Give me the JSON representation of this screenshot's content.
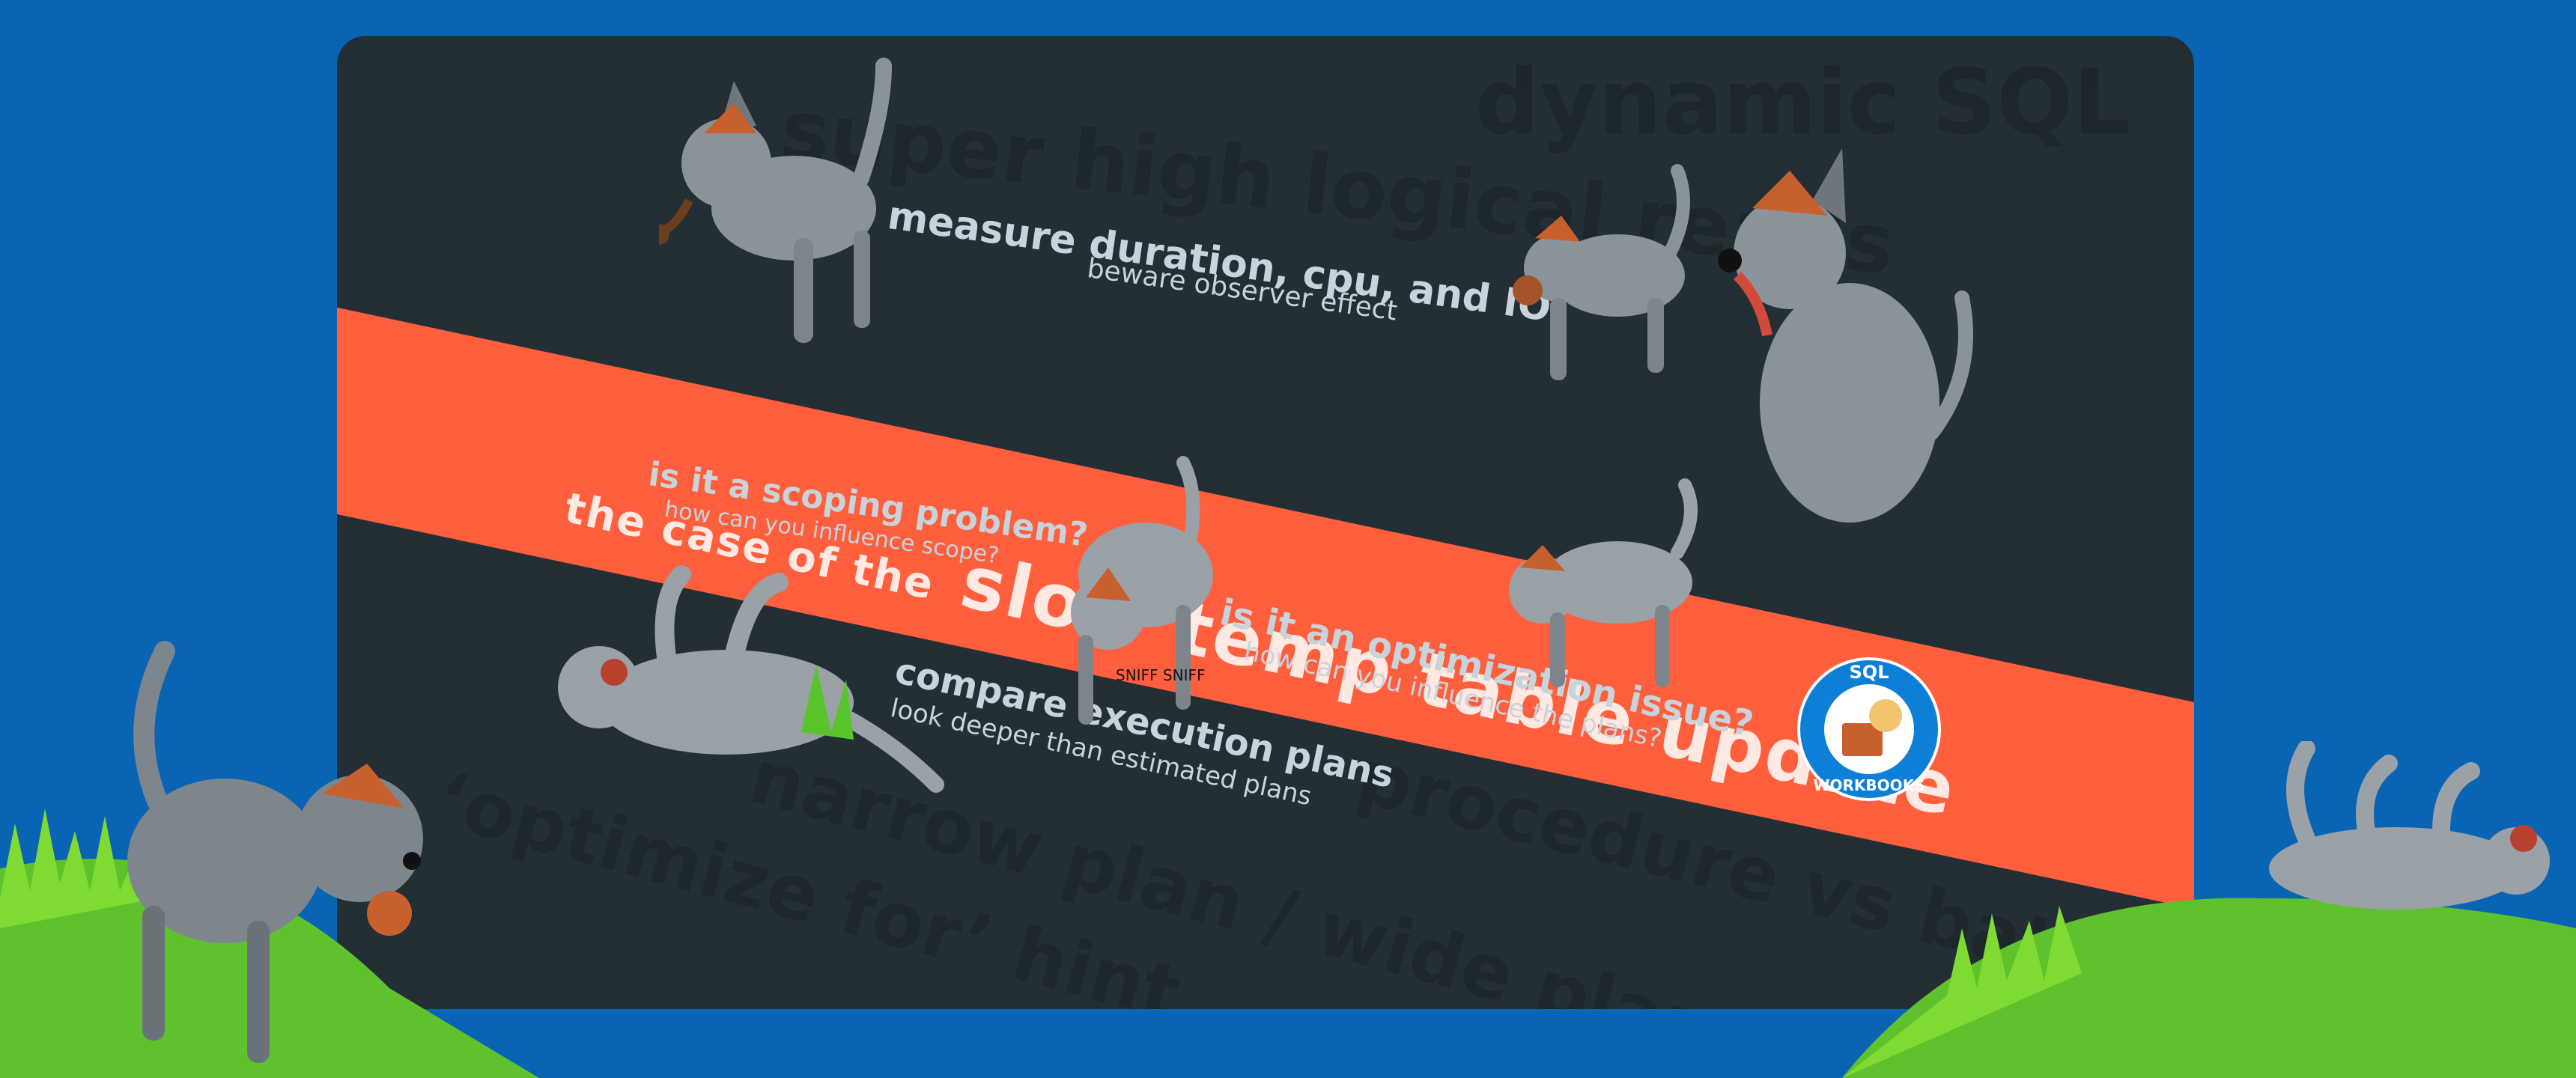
{
  "title": {
    "lead": "the case of the",
    "rest": "slow temp table update"
  },
  "notes": {
    "measure": {
      "main": "measure duration, cpu, and IO",
      "sub": "beware observer effect"
    },
    "scoping": {
      "main": "is it a scoping problem?",
      "sub": "how can you influence scope?"
    },
    "optimization": {
      "main": "is it an optimization issue?",
      "sub": "how can you influence the plans?"
    },
    "compare": {
      "main": "compare execution plans",
      "sub": "look deeper than estimated plans"
    }
  },
  "background_phrases": {
    "dynamic_sql": "dynamic SQL",
    "logical_reads": "super high logical reads",
    "narrow_wide": "narrow plan / wide plan",
    "optimize_for": "‘optimize for’ hint",
    "procedure_batch": "procedure vs batch"
  },
  "dog_caption": "SNIFF SNIFF",
  "logo": {
    "top": "SQL",
    "bottom": "WORKBOOKS"
  },
  "colors": {
    "page_bg": "#0a64b4",
    "panel_bg": "#232f35",
    "band": "#ff5f3d",
    "text_light": "#c9d3db",
    "dog": "#8a939a",
    "hat": "#c8602e",
    "grass": "#6ccf2e"
  }
}
